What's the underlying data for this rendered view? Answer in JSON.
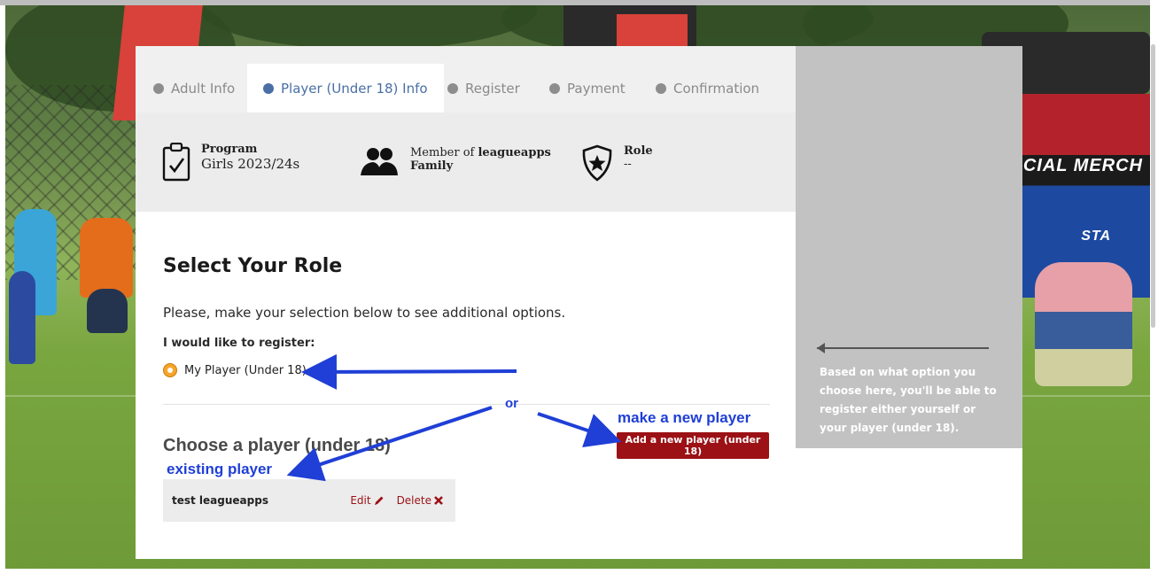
{
  "tabs": [
    {
      "label": "Adult Info"
    },
    {
      "label": "Player (Under 18) Info"
    },
    {
      "label": "Register"
    },
    {
      "label": "Payment"
    },
    {
      "label": "Confirmation"
    }
  ],
  "info": {
    "program_label": "Program",
    "program_value": "Girls 2023/24s",
    "member_prefix": "Member of",
    "member_org": "leagueapps",
    "member_family": "Family",
    "role_label": "Role",
    "role_value": "--"
  },
  "main": {
    "heading": "Select Your Role",
    "description": "Please, make your selection below to see additional options.",
    "register_label": "I would like to register:",
    "radio_option": "My Player (Under 18)",
    "choose_heading": "Choose a player (under 18)",
    "add_button": "Add a new player (under 18)",
    "players": [
      {
        "name": "test leagueapps",
        "edit": "Edit",
        "delete": "Delete"
      }
    ]
  },
  "side": {
    "note": "Based on what option you choose here, you'll be able to register either yourself or your player (under 18)."
  },
  "annotations": {
    "or": "or",
    "make_new": "make a new player",
    "existing": "existing player",
    "color": "#1f3fd6"
  },
  "background_text": {
    "tent": "CIAL MERCH",
    "tent2": "STA"
  },
  "colors": {
    "accent": "#4a6fa5",
    "button": "#9b1115",
    "radio": "#f6a52b"
  }
}
